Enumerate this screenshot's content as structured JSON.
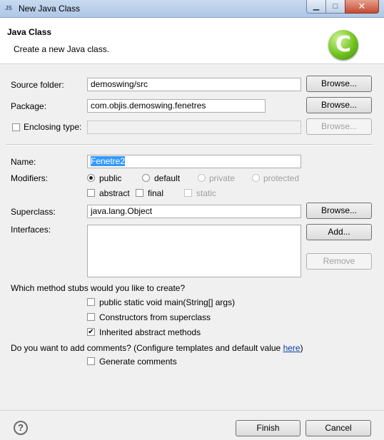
{
  "window": {
    "title": "New Java Class",
    "icon": "java-icon",
    "icon_text": "JS"
  },
  "titlebar_buttons": {
    "minimize": "▁",
    "maximize": "□",
    "close": "✕"
  },
  "header": {
    "title": "Java Class",
    "description": "Create a new Java class.",
    "logo_letter": "C"
  },
  "form": {
    "source_folder": {
      "label": "Source folder:",
      "value": "demoswing/src",
      "browse": "Browse..."
    },
    "package": {
      "label": "Package:",
      "value": "com.objis.demoswing.fenetres",
      "browse": "Browse..."
    },
    "enclosing_type": {
      "label": "Enclosing type:",
      "value": "",
      "browse": "Browse...",
      "checked": false
    },
    "name": {
      "label": "Name:",
      "value": "Fenetre2"
    },
    "modifiers": {
      "label": "Modifiers:",
      "public": "public",
      "default": "default",
      "private": "private",
      "protected": "protected",
      "abstract": "abstract",
      "final": "final",
      "static": "static",
      "selected": "public"
    },
    "superclass": {
      "label": "Superclass:",
      "value": "java.lang.Object",
      "browse": "Browse..."
    },
    "interfaces": {
      "label": "Interfaces:",
      "add": "Add...",
      "remove": "Remove"
    },
    "stubs": {
      "question": "Which method stubs would you like to create?",
      "main": "public static void main(String[] args)",
      "constructors": "Constructors from superclass",
      "inherited": "Inherited abstract methods",
      "main_checked": false,
      "constructors_checked": false,
      "inherited_checked": true
    },
    "comments": {
      "question": "Do you want to add comments? (Configure templates and default value ",
      "link": "here",
      "closing": ")",
      "generate": "Generate comments",
      "generate_checked": false
    }
  },
  "footer": {
    "help": "?",
    "finish": "Finish",
    "cancel": "Cancel"
  },
  "check_mark": "✔"
}
